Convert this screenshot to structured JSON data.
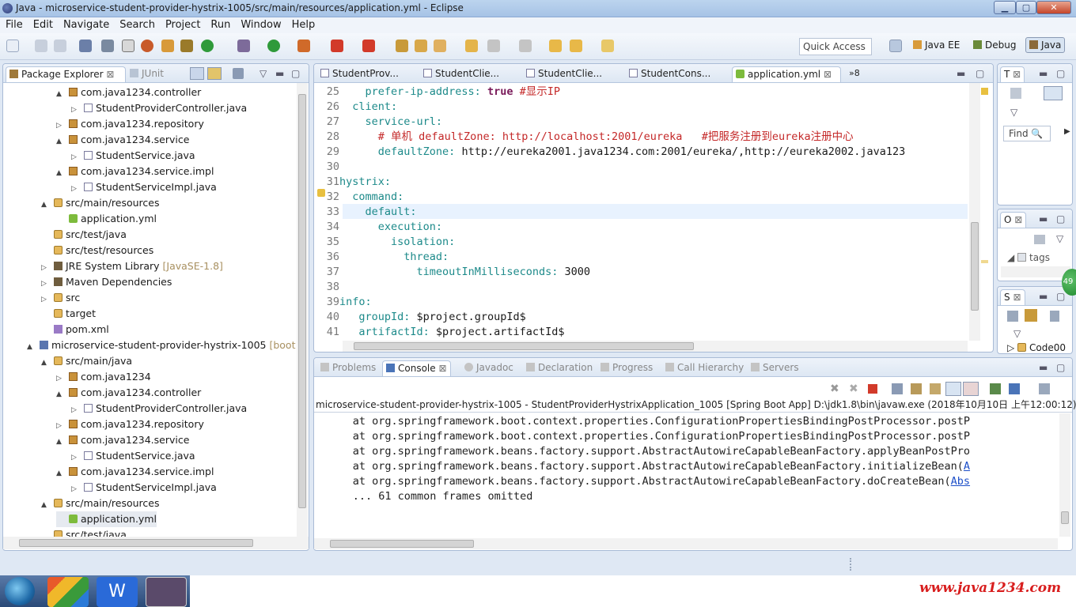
{
  "window": {
    "title": "Java - microservice-student-provider-hystrix-1005/src/main/resources/application.yml - Eclipse"
  },
  "menu": [
    "File",
    "Edit",
    "Navigate",
    "Search",
    "Project",
    "Run",
    "Window",
    "Help"
  ],
  "toolbar": {
    "quick_access_placeholder": "Quick Access",
    "perspectives": [
      "Java EE",
      "Debug",
      "Java"
    ]
  },
  "package_explorer": {
    "tabs": [
      "Package Explorer",
      "JUnit"
    ],
    "rows": [
      {
        "label": "com.java1234.controller",
        "icon": "pkg",
        "indent": 1,
        "tw": "▲"
      },
      {
        "label": "StudentProviderController.java",
        "icon": "jfile",
        "indent": 2,
        "tw": "▷"
      },
      {
        "label": "com.java1234.repository",
        "icon": "pkg",
        "indent": 1,
        "tw": "▷"
      },
      {
        "label": "com.java1234.service",
        "icon": "pkg",
        "indent": 1,
        "tw": "▲"
      },
      {
        "label": "StudentService.java",
        "icon": "jfile",
        "indent": 2,
        "tw": "▷"
      },
      {
        "label": "com.java1234.service.impl",
        "icon": "pkg",
        "indent": 1,
        "tw": "▲"
      },
      {
        "label": "StudentServiceImpl.java",
        "icon": "jfile",
        "indent": 2,
        "tw": "▷"
      },
      {
        "label": "src/main/resources",
        "icon": "folder",
        "indent": 0,
        "tw": "▲"
      },
      {
        "label": "application.yml",
        "icon": "yml",
        "indent": 1,
        "tw": ""
      },
      {
        "label": "src/test/java",
        "icon": "folder",
        "indent": 0,
        "tw": ""
      },
      {
        "label": "src/test/resources",
        "icon": "folder",
        "indent": 0,
        "tw": ""
      },
      {
        "label": "JRE System Library",
        "suffix": "[JavaSE-1.8]",
        "icon": "jar",
        "indent": 0,
        "tw": "▷"
      },
      {
        "label": "Maven Dependencies",
        "icon": "jar",
        "indent": 0,
        "tw": "▷"
      },
      {
        "label": "src",
        "icon": "folder",
        "indent": 0,
        "tw": "▷"
      },
      {
        "label": "target",
        "icon": "folder",
        "indent": 0,
        "tw": ""
      },
      {
        "label": "pom.xml",
        "icon": "xml",
        "indent": 0,
        "tw": ""
      },
      {
        "label": "microservice-student-provider-hystrix-1005",
        "suffix": "[boot] [d",
        "icon": "proj",
        "indent": -1,
        "tw": "▲"
      },
      {
        "label": "src/main/java",
        "icon": "folder",
        "indent": 0,
        "tw": "▲"
      },
      {
        "label": "com.java1234",
        "icon": "pkg",
        "indent": 1,
        "tw": "▷"
      },
      {
        "label": "com.java1234.controller",
        "icon": "pkg",
        "indent": 1,
        "tw": "▲"
      },
      {
        "label": "StudentProviderController.java",
        "icon": "jfile",
        "indent": 2,
        "tw": "▷"
      },
      {
        "label": "com.java1234.repository",
        "icon": "pkg",
        "indent": 1,
        "tw": "▷"
      },
      {
        "label": "com.java1234.service",
        "icon": "pkg",
        "indent": 1,
        "tw": "▲"
      },
      {
        "label": "StudentService.java",
        "icon": "jfile",
        "indent": 2,
        "tw": "▷"
      },
      {
        "label": "com.java1234.service.impl",
        "icon": "pkg",
        "indent": 1,
        "tw": "▲"
      },
      {
        "label": "StudentServiceImpl.java",
        "icon": "jfile",
        "indent": 2,
        "tw": "▷"
      },
      {
        "label": "src/main/resources",
        "icon": "folder",
        "indent": 0,
        "tw": "▲"
      },
      {
        "label": "application.yml",
        "icon": "yml",
        "indent": 1,
        "tw": ""
      },
      {
        "label": "src/test/java",
        "icon": "folder",
        "indent": 0,
        "tw": ""
      }
    ]
  },
  "editor": {
    "tabs": [
      "StudentProv...",
      "StudentClie...",
      "StudentClie...",
      "StudentCons...",
      "application.yml",
      "»8"
    ],
    "lines": [
      {
        "n": "25",
        "parts": [
          [
            "",
            "    "
          ],
          [
            "k",
            "prefer-ip-address:"
          ],
          [
            "v",
            " "
          ],
          [
            "b",
            "true"
          ],
          [
            "v",
            " "
          ],
          [
            "c",
            "#显示IP"
          ]
        ]
      },
      {
        "n": "26",
        "parts": [
          [
            "",
            "  "
          ],
          [
            "k",
            "client:"
          ]
        ]
      },
      {
        "n": "27",
        "parts": [
          [
            "",
            "    "
          ],
          [
            "k",
            "service-url:"
          ]
        ]
      },
      {
        "n": "28",
        "parts": [
          [
            "",
            "      "
          ],
          [
            "c",
            "# 单机 defaultZone: http://localhost:2001/eureka   #把服务注册到eureka注册中心"
          ]
        ]
      },
      {
        "n": "29",
        "parts": [
          [
            "",
            "      "
          ],
          [
            "k",
            "defaultZone:"
          ],
          [
            "v",
            " http://eureka2001.java1234.com:2001/eureka/,http://eureka2002.java123"
          ]
        ]
      },
      {
        "n": "30",
        "parts": []
      },
      {
        "n": "31",
        "parts": [
          [
            "k",
            "hystrix:"
          ]
        ]
      },
      {
        "n": "32",
        "parts": [
          [
            "",
            "  "
          ],
          [
            "k",
            "command:"
          ]
        ]
      },
      {
        "n": "33",
        "parts": [
          [
            "",
            "    "
          ],
          [
            "k",
            "default:"
          ]
        ]
      },
      {
        "n": "34",
        "parts": [
          [
            "",
            "      "
          ],
          [
            "k",
            "execution:"
          ]
        ]
      },
      {
        "n": "35",
        "parts": [
          [
            "",
            "        "
          ],
          [
            "k",
            "isolation:"
          ]
        ]
      },
      {
        "n": "36",
        "parts": [
          [
            "",
            "          "
          ],
          [
            "k",
            "thread:"
          ]
        ]
      },
      {
        "n": "37",
        "parts": [
          [
            "",
            "            "
          ],
          [
            "k",
            "timeoutInMilliseconds:"
          ],
          [
            "v",
            " 3000"
          ]
        ]
      },
      {
        "n": "38",
        "parts": []
      },
      {
        "n": "39",
        "parts": [
          [
            "k",
            "info:"
          ]
        ]
      },
      {
        "n": "40",
        "parts": [
          [
            "",
            "   "
          ],
          [
            "k",
            "groupId:"
          ],
          [
            "v",
            " $project.groupId$"
          ]
        ]
      },
      {
        "n": "41",
        "parts": [
          [
            "",
            "   "
          ],
          [
            "k",
            "artifactId:"
          ],
          [
            "v",
            " $project.artifactId$"
          ]
        ]
      }
    ]
  },
  "right_panels": {
    "task_tab": "T",
    "find_label": "Find",
    "outline_tab": "O",
    "outline_text": "tags",
    "servers_tab": "S",
    "servers_text": "Code00"
  },
  "console": {
    "tabs": [
      "Problems",
      "Console",
      "Javadoc",
      "Declaration",
      "Progress",
      "Call Hierarchy",
      "Servers"
    ],
    "header": "microservice-student-provider-hystrix-1005 - StudentProviderHystrixApplication_1005 [Spring Boot App] D:\\jdk1.8\\bin\\javaw.exe (2018年10月10日 上午12:00:12)",
    "lines": [
      {
        "t": "      at org.springframework.boot.context.properties.ConfigurationPropertiesBindingPostProcessor.postP",
        "link": ""
      },
      {
        "t": "      at org.springframework.boot.context.properties.ConfigurationPropertiesBindingPostProcessor.postP",
        "link": ""
      },
      {
        "t": "      at org.springframework.beans.factory.support.AbstractAutowireCapableBeanFactory.applyBeanPostPro",
        "link": ""
      },
      {
        "t": "      at org.springframework.beans.factory.support.AbstractAutowireCapableBeanFactory.initializeBean(",
        "link": "A"
      },
      {
        "t": "      at org.springframework.beans.factory.support.AbstractAutowireCapableBeanFactory.doCreateBean(",
        "link": "Abs"
      },
      {
        "t": "      ... 61 common frames omitted",
        "link": ""
      }
    ]
  },
  "watermark": "www.java1234.com",
  "badge": "49",
  "colors": {
    "accent": "#4a74b8",
    "watermark": "#d81e1e"
  }
}
